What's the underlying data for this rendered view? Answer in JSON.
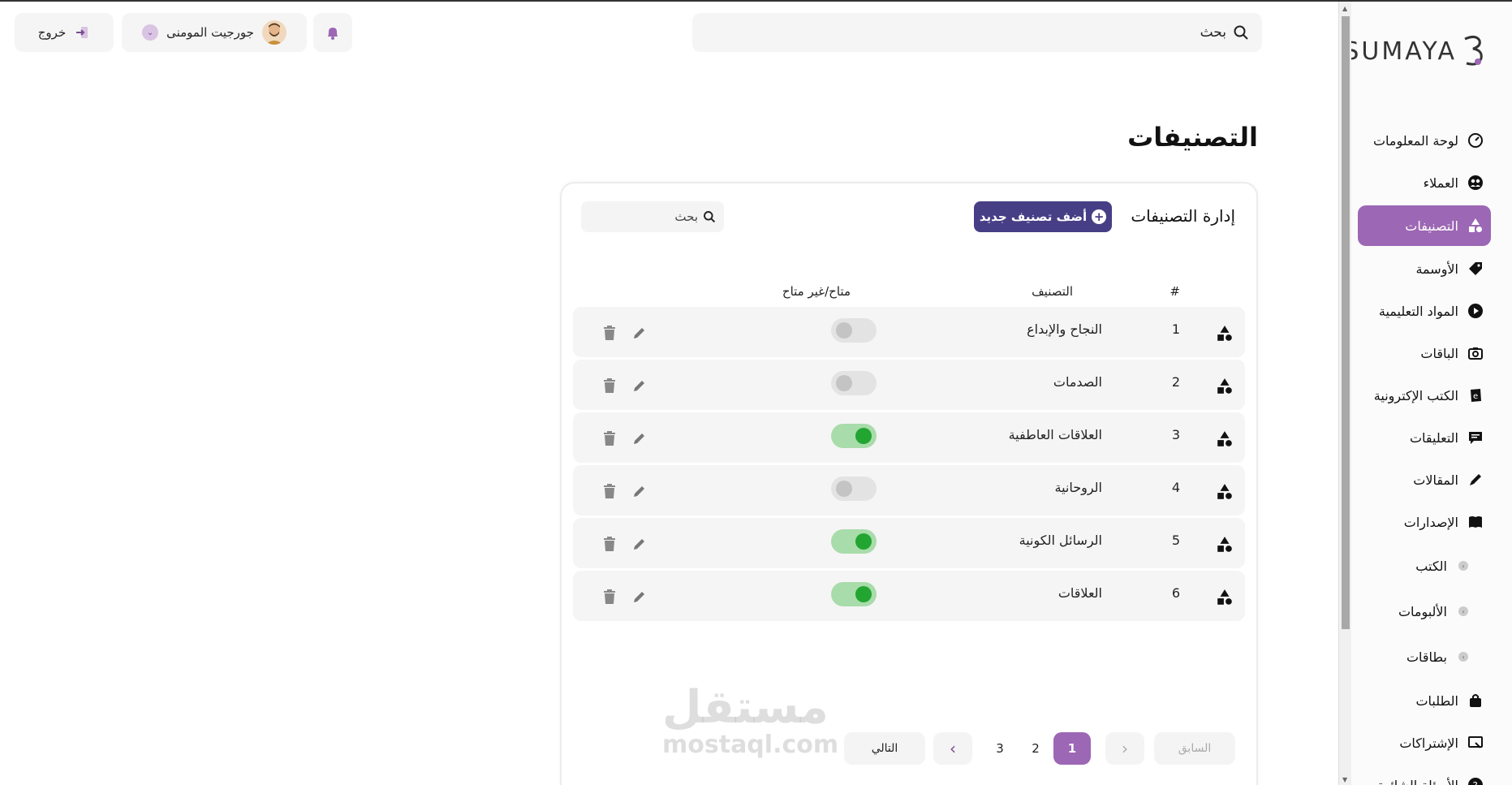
{
  "brand": {
    "logo_text": "SUMAYA"
  },
  "colors": {
    "accent": "#9c67b4",
    "primary_button": "#463f86",
    "toggle_on": "#23a531"
  },
  "sidebar": {
    "items": [
      {
        "label": "لوحة المعلومات",
        "icon": "gauge-icon"
      },
      {
        "label": "العملاء",
        "icon": "users-icon"
      },
      {
        "label": "التصنيفات",
        "icon": "shapes-icon",
        "active": true
      },
      {
        "label": "الأوسمة",
        "icon": "tag-icon"
      },
      {
        "label": "المواد التعليمية",
        "icon": "play-icon"
      },
      {
        "label": "الباقات",
        "icon": "camera-icon"
      },
      {
        "label": "الكتب الإكترونية",
        "icon": "ebook-icon"
      },
      {
        "label": "التعليقات",
        "icon": "comment-icon"
      },
      {
        "label": "المقالات",
        "icon": "pen-icon"
      },
      {
        "label": "الإصدارات",
        "icon": "book-icon"
      },
      {
        "label": "الكتب",
        "sub": true
      },
      {
        "label": "الألبومات",
        "sub": true
      },
      {
        "label": "بطاقات",
        "sub": true
      },
      {
        "label": "الطلبات",
        "icon": "bag-icon"
      },
      {
        "label": "الإشتراكات",
        "icon": "subscription-icon"
      },
      {
        "label": "الأسئلة الشائعة",
        "icon": "help-icon"
      }
    ]
  },
  "header": {
    "search_label": "بحث",
    "user_name": "جورجيت المومنى",
    "logout_label": "خروج"
  },
  "page": {
    "title": "التصنيفات"
  },
  "card": {
    "title": "إدارة التصنيفات",
    "add_button": "أضف تصنيف جديد",
    "search_label": "بحث"
  },
  "table": {
    "headers": {
      "index": "#",
      "category": "التصنيف",
      "availability": "متاح/غير متاح"
    },
    "rows": [
      {
        "num": "1",
        "name": "النجاح والإبداع",
        "available": false
      },
      {
        "num": "2",
        "name": "الصدمات",
        "available": false
      },
      {
        "num": "3",
        "name": "العلاقات العاطفية",
        "available": true
      },
      {
        "num": "4",
        "name": "الروحانية",
        "available": false
      },
      {
        "num": "5",
        "name": "الرسائل الكونية",
        "available": true
      },
      {
        "num": "6",
        "name": "العلاقات",
        "available": true
      }
    ]
  },
  "pagination": {
    "prev_label": "السابق",
    "next_label": "التالي",
    "pages": [
      "1",
      "2",
      "3"
    ],
    "current_page": "1"
  },
  "watermark": {
    "arabic": "مستقل",
    "latin": "mostaql.com"
  }
}
